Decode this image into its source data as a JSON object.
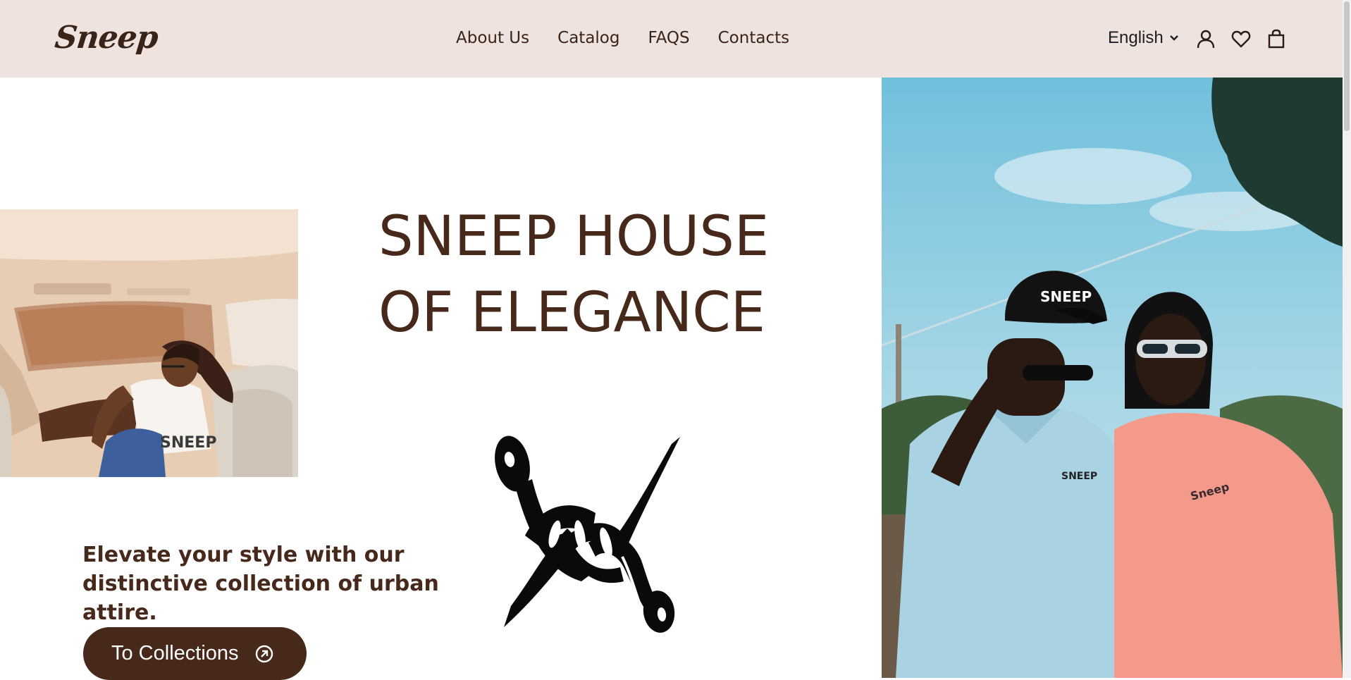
{
  "header": {
    "logo": "Sneep",
    "nav": [
      "About Us",
      "Catalog",
      "FAQS",
      "Contacts"
    ],
    "language": "English",
    "icons": [
      "chevron-down-icon",
      "user-icon",
      "heart-icon",
      "shopping-bag-icon"
    ]
  },
  "hero": {
    "title_line1": "SNEEP HOUSE",
    "title_line2": "OF ELEGANCE",
    "tagline": "Elevate your style with our distinctive collection of urban attire.",
    "cta_label": "To Collections",
    "cta_icon": "arrow-up-right-circle-icon"
  },
  "photos": {
    "left_shirt_print": "SNEEP",
    "cap_print": "SNEEP",
    "polo_print": "SNEEP",
    "tee_print": "Sneep"
  },
  "colors": {
    "brand_brown": "#46291a",
    "header_bg": "#efe3df",
    "page_bg": "#ffffff"
  }
}
